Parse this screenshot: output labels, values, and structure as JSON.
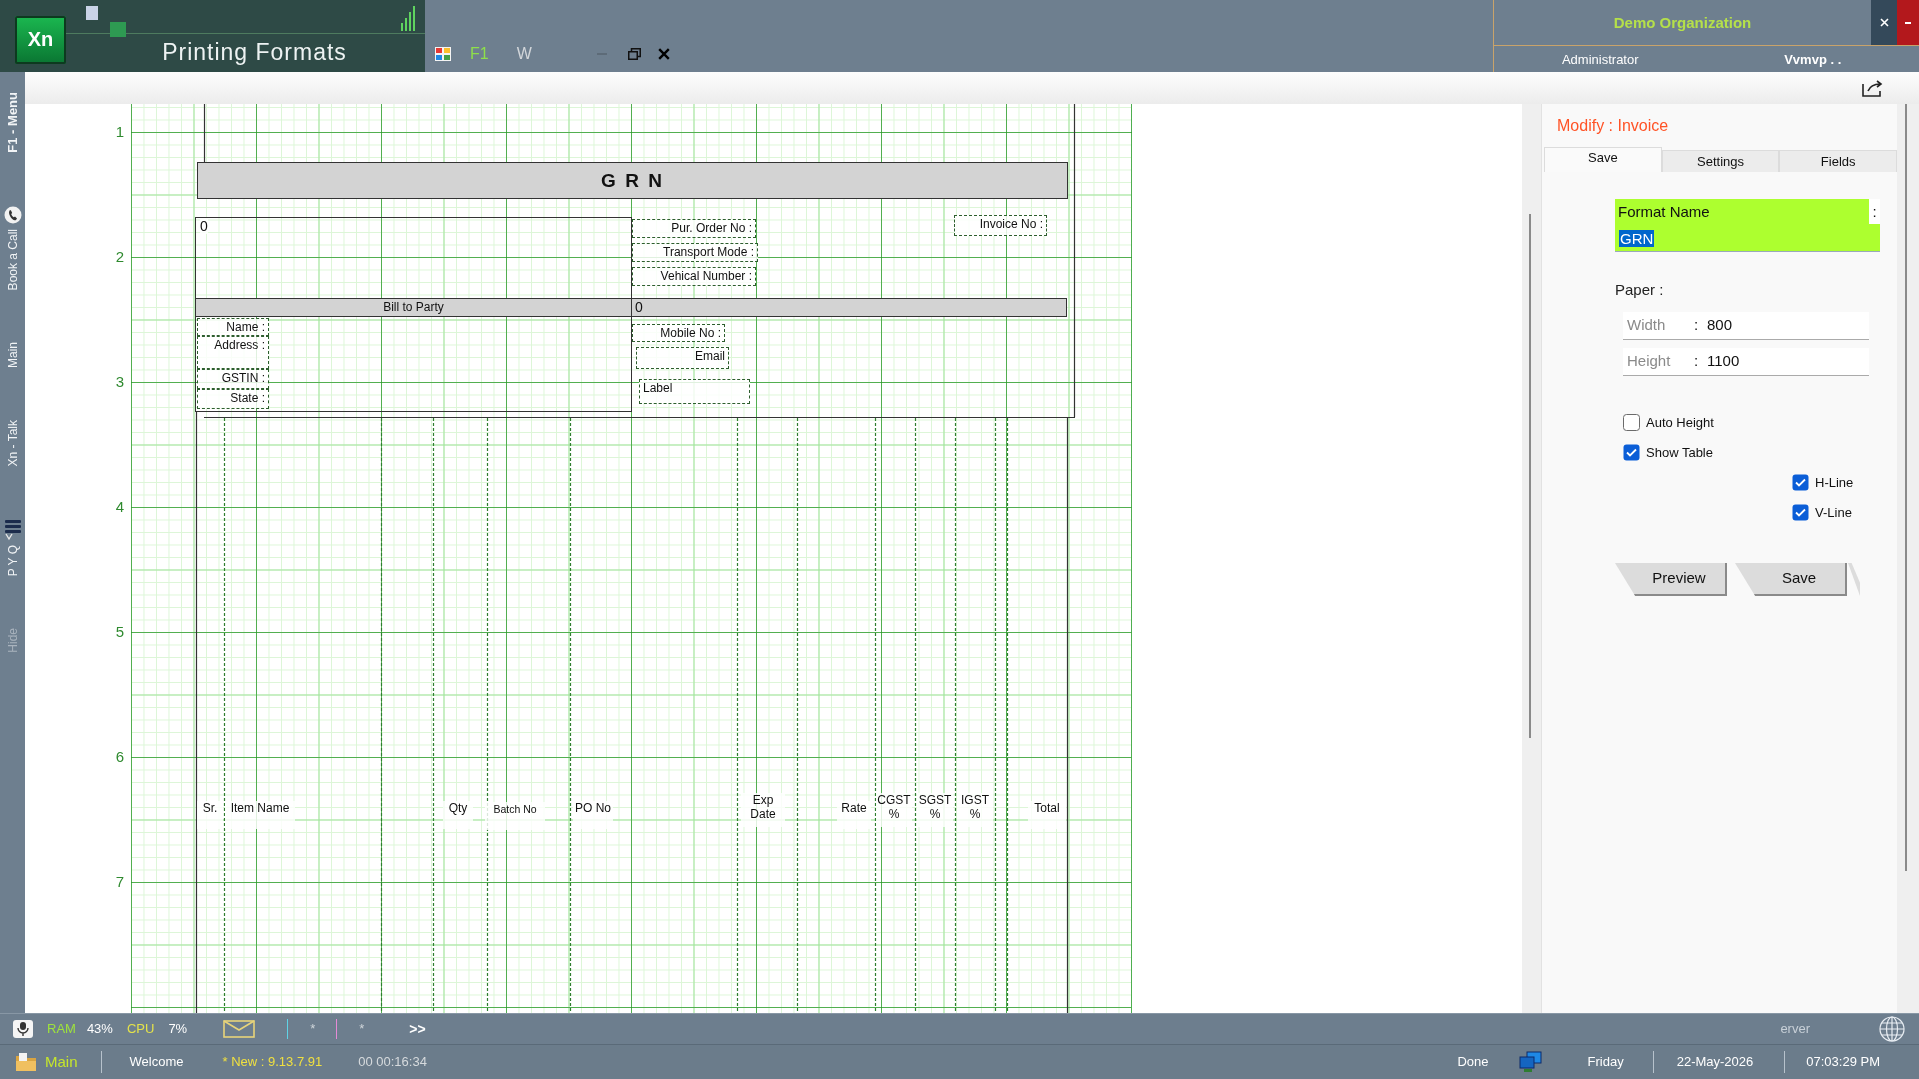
{
  "title_bar": {
    "logo": "Xn",
    "title": "Printing Formats",
    "shortcuts": [
      {
        "label": "F1",
        "kind": "key"
      },
      {
        "label": "W",
        "kind": "plain"
      }
    ]
  },
  "organization": {
    "name": "Demo Organization",
    "user": "Administrator",
    "company": "Vvmvp . ."
  },
  "side_menu": [
    {
      "label": "F1 - Menu",
      "kind": "heading"
    },
    {
      "label": "Book a Call",
      "kind": "phone"
    },
    {
      "label": "Main",
      "kind": "link"
    },
    {
      "label": "Xn - Talk",
      "kind": "link"
    },
    {
      "label": "P Y Q",
      "kind": "list"
    },
    {
      "label": "Hide",
      "kind": "muted"
    }
  ],
  "designer": {
    "ruler": [
      "1",
      "2",
      "3",
      "4",
      "5",
      "6",
      "7"
    ],
    "title_band": "G R N",
    "party_box": {
      "value": "0"
    },
    "bill_band": "Bill to Party",
    "ship_band": "0",
    "order_fields": [
      "Pur. Order No :",
      "Transport Mode :",
      "Vehical Number :"
    ],
    "invoice_field": "Invoice No :",
    "party_fields": [
      "Name :",
      "Address :",
      "GSTIN :",
      "State :"
    ],
    "contact_fields": [
      "Mobile No :",
      "Email",
      "Label"
    ],
    "table_columns": [
      "Sr.",
      "Item Name",
      "Qty",
      "Batch No",
      "PO No",
      "Exp Date",
      "Rate",
      "CGST %",
      "SGST %",
      "IGST %",
      "Total"
    ]
  },
  "panel": {
    "title": "Modify : Invoice",
    "tabs": [
      {
        "label": "Save",
        "selected": true
      },
      {
        "label": "Settings",
        "selected": false
      },
      {
        "label": "Fields",
        "selected": false
      }
    ],
    "format_name": {
      "label": "Format Name",
      "separator": ":",
      "value": "GRN"
    },
    "paper": {
      "label": "Paper :",
      "fields": [
        {
          "label": "Width",
          "separator": ":",
          "value": "800"
        },
        {
          "label": "Height",
          "separator": ":",
          "value": "1100"
        }
      ]
    },
    "options": [
      {
        "label": "Auto Height",
        "checked": false,
        "kind": "main"
      },
      {
        "label": "Show Table",
        "checked": true,
        "kind": "main"
      },
      {
        "label": "H-Line",
        "checked": true,
        "kind": "sub"
      },
      {
        "label": "V-Line",
        "checked": true,
        "kind": "sub"
      }
    ],
    "buttons": [
      "Preview",
      "Save"
    ]
  },
  "status_bar": {
    "ram_label": "RAM",
    "ram_value": "43%",
    "cpu_label": "CPU",
    "cpu_value": "7%",
    "marks": [
      "*",
      "*"
    ],
    "more": ">>",
    "server": "erver"
  },
  "footer": {
    "module": "Main",
    "greeting": "Welcome",
    "version": "* New : 9.13.7.91",
    "elapsed": "00 00:16:34",
    "state": "Done",
    "day": "Friday",
    "date": "22-May-2026",
    "time": "07:03:29 PM"
  }
}
